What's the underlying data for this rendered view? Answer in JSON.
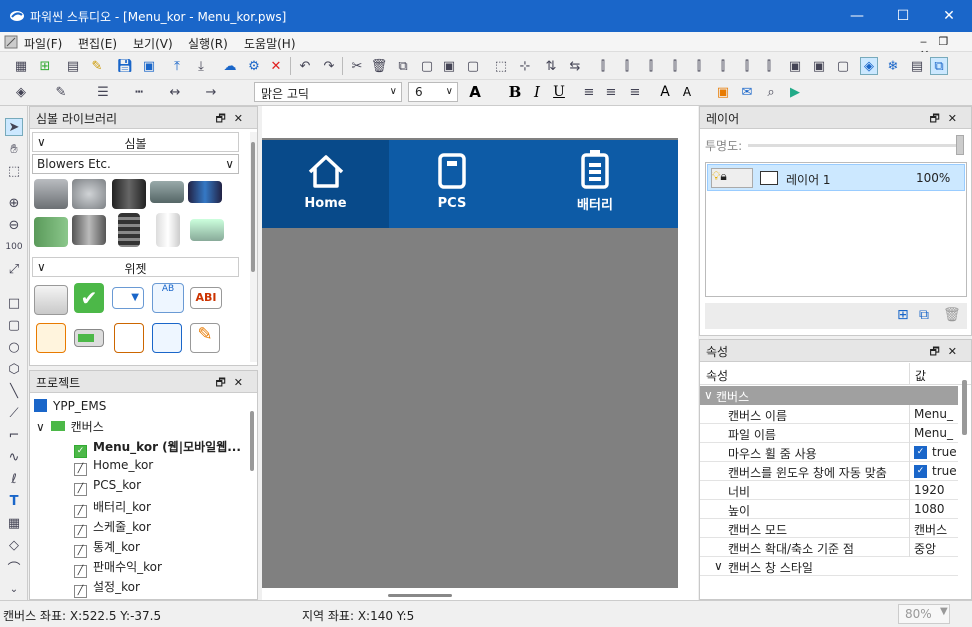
{
  "window": {
    "title": "파워씬 스튜디오 - [Menu_kor - Menu_kor.pws]",
    "minimize": "—",
    "maximize": "☐",
    "close": "✕"
  },
  "menu": {
    "items": [
      "파일(F)",
      "편집(E)",
      "보기(V)",
      "실행(R)",
      "도움말(H)"
    ],
    "mdi_controls": "‒ ❐ ✕"
  },
  "toolbar2": {
    "font_name": "맑은 고딕",
    "font_size": "6"
  },
  "symbol_library": {
    "header": "심볼 라이브러리",
    "symbols_section": "심볼",
    "category": "Blowers Etc.",
    "widgets_section": "위젯"
  },
  "project": {
    "header": "프로젝트",
    "root": "YPP_EMS",
    "canvas_folder": "캔버스",
    "items": [
      "Menu_kor (웹|모바일웹...",
      "Home_kor",
      "PCS_kor",
      "배터리_kor",
      "스케줄_kor",
      "통계_kor",
      "판매수익_kor",
      "설정_kor"
    ]
  },
  "canvas": {
    "nav": [
      {
        "label": "Home",
        "icon": "home-icon"
      },
      {
        "label": "PCS",
        "icon": "pcs-icon"
      },
      {
        "label": "배터리",
        "icon": "battery-icon"
      }
    ]
  },
  "layers": {
    "header": "레이어",
    "opacity_label": "투명도:",
    "layer_name": "레이어 1",
    "layer_opacity": "100%"
  },
  "properties": {
    "header": "속성",
    "col_property": "속성",
    "col_value": "값",
    "group_canvas": "캔버스",
    "rows": [
      {
        "key": "캔버스 이름",
        "value": "Menu_k"
      },
      {
        "key": "파일 이름",
        "value": "Menu_k"
      },
      {
        "key": "마우스 휠 줌 사용",
        "value": "true",
        "checkbox": true
      },
      {
        "key": "캔버스를 윈도우 창에 자동 맞춤",
        "value": "true",
        "checkbox": true
      },
      {
        "key": "너비",
        "value": "1920"
      },
      {
        "key": "높이",
        "value": "1080"
      },
      {
        "key": "캔버스 모드",
        "value": "캔버스"
      },
      {
        "key": "캔버스 확대/축소 기준 점",
        "value": "중앙"
      }
    ],
    "subgroup": "캔버스 창 스타일"
  },
  "status": {
    "canvas_coords": "캔버스 좌표: X:522.5 Y:-37.5",
    "local_coords": "지역 좌표: X:140 Y:5",
    "zoom": "80%"
  },
  "colors": {
    "titlebar": "#1a66c9",
    "nav_bg": "#0d5ba6",
    "nav_active": "#084a8a",
    "canvas_bg": "#808080",
    "selection": "#cce8ff"
  }
}
